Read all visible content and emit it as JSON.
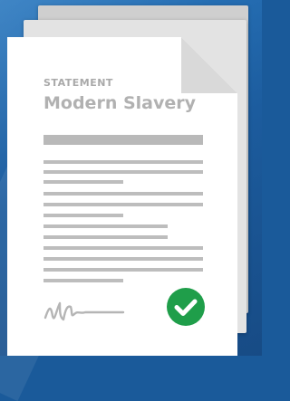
{
  "document": {
    "label": "STATEMENT",
    "title": "Modern Slavery"
  },
  "colors": {
    "background": "#1c5c9e",
    "paper": "#ffffff",
    "text_grey": "#b1b1b1",
    "check_green": "#1f9e4a"
  },
  "icons": {
    "signature": "signature-icon",
    "check": "check-circle-icon"
  }
}
